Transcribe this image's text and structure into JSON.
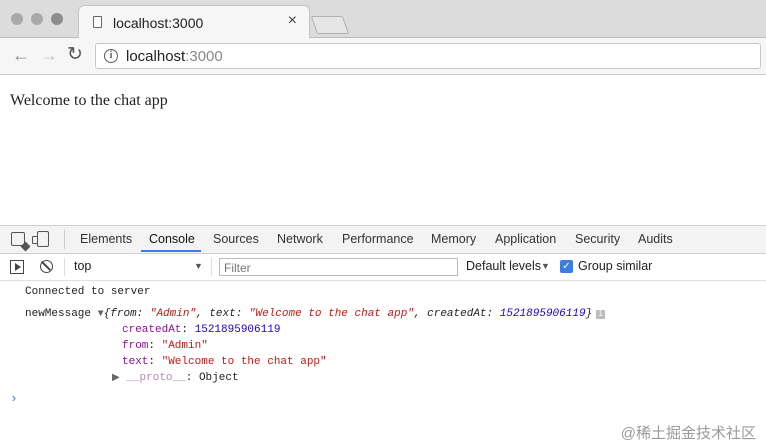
{
  "browser": {
    "tab": {
      "title": "localhost:3000",
      "close_glyph": "×"
    },
    "address": {
      "host": "localhost",
      "port": ":3000"
    },
    "nav": {
      "back": "←",
      "forward": "→",
      "reload": "↻"
    },
    "info_glyph": "i"
  },
  "page": {
    "heading": "Welcome to the chat app"
  },
  "devtools": {
    "tabs": [
      "Elements",
      "Console",
      "Sources",
      "Network",
      "Performance",
      "Memory",
      "Application",
      "Security",
      "Audits"
    ],
    "active_tab": "Console",
    "console_bar": {
      "context": "top",
      "filter_placeholder": "Filter",
      "levels": "Default levels",
      "group_similar": "Group similar",
      "group_similar_checked": true
    },
    "console": {
      "line1": "Connected to server",
      "label": "newMessage",
      "preview": {
        "open": "{",
        "from_key": "from",
        "from_val": "\"Admin\"",
        "text_key": "text",
        "text_val": "\"Welcome to the chat app\"",
        "created_key": "createdAt",
        "created_val": "1521895906119",
        "close": "}"
      },
      "expanded": {
        "createdAt_key": "createdAt",
        "createdAt_val": "1521895906119",
        "from_key": "from",
        "from_val": "\"Admin\"",
        "text_key": "text",
        "text_val": "\"Welcome to the chat app\"",
        "proto_key": "__proto__",
        "proto_val": "Object"
      },
      "prompt": "›"
    }
  },
  "watermark": "@稀土掘金技术社区"
}
